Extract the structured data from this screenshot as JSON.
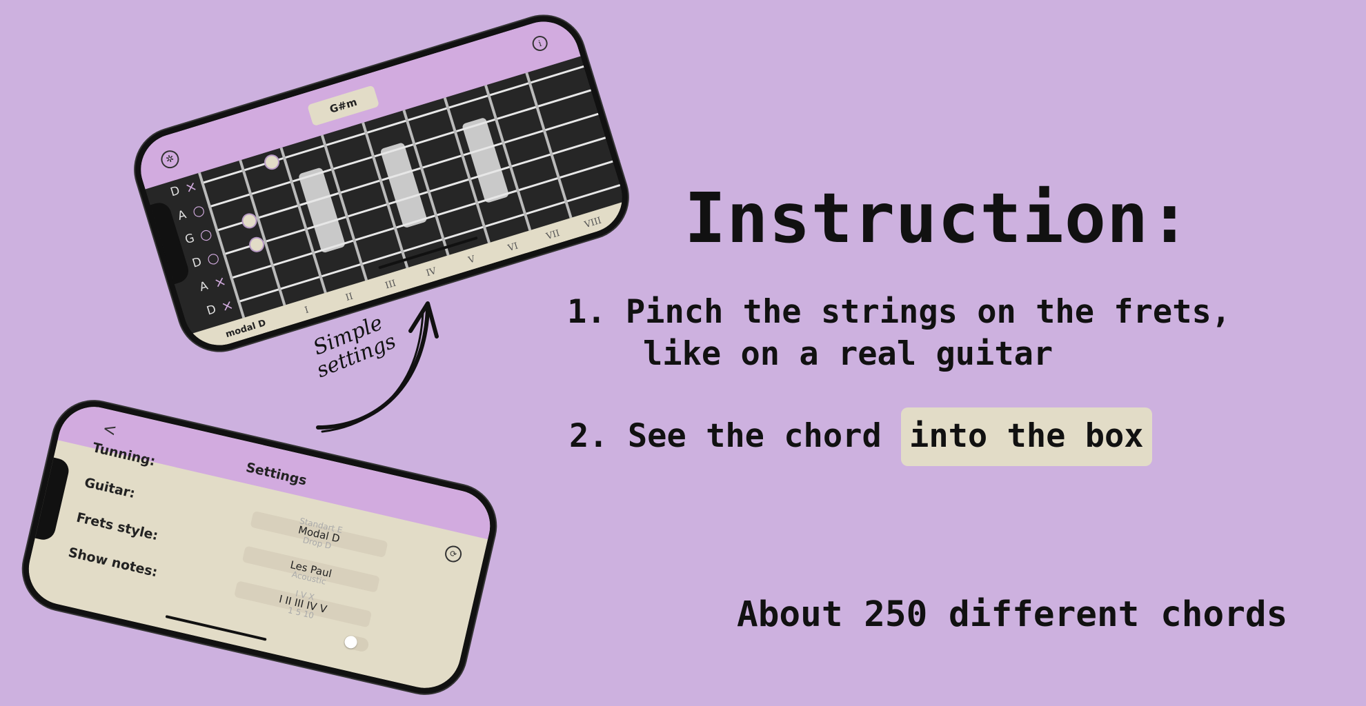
{
  "instruction": {
    "title": "Instruction:",
    "step1_line1": "1. Pinch the strings on the frets,",
    "step1_line2": "like on a real guitar",
    "step2_prefix": "2. See the chord",
    "step2_box": "into the box",
    "footer": "About 250 different chords"
  },
  "arrow_caption": {
    "line1": "Simple",
    "line2": "settings"
  },
  "fretboard_phone": {
    "chord": "G#m",
    "tuning_label": "modal D",
    "strings": [
      "D",
      "A",
      "G",
      "D",
      "A",
      "D"
    ],
    "string_marks": [
      "×",
      "○",
      "○",
      "○",
      "×",
      "×"
    ],
    "fret_numbers": [
      "I",
      "II",
      "III",
      "IV",
      "V",
      "VI",
      "VII",
      "VIII"
    ],
    "icons": {
      "settings": "gear-icon",
      "info": "info-icon"
    }
  },
  "settings_phone": {
    "title": "Settings",
    "back": "<",
    "rows": [
      {
        "label": "Tunning:",
        "ghost_top": "Standart E",
        "value": "Modal D",
        "ghost_bottom": "Drop D"
      },
      {
        "label": "Guitar:",
        "ghost_top": "",
        "value": "Les Paul",
        "ghost_bottom": "Acoustic"
      },
      {
        "label": "Frets style:",
        "ghost_top": "I V X",
        "value": "I II III IV V",
        "ghost_bottom": "1 5 10"
      },
      {
        "label": "Show notes:",
        "ghost_top": "",
        "value": "",
        "ghost_bottom": ""
      }
    ],
    "show_notes_on": false,
    "icons": {
      "refresh": "refresh-icon"
    }
  },
  "colors": {
    "background": "#cdb1df",
    "accent": "#d2abdf",
    "beige": "#e2dcc7",
    "board": "#262626"
  }
}
